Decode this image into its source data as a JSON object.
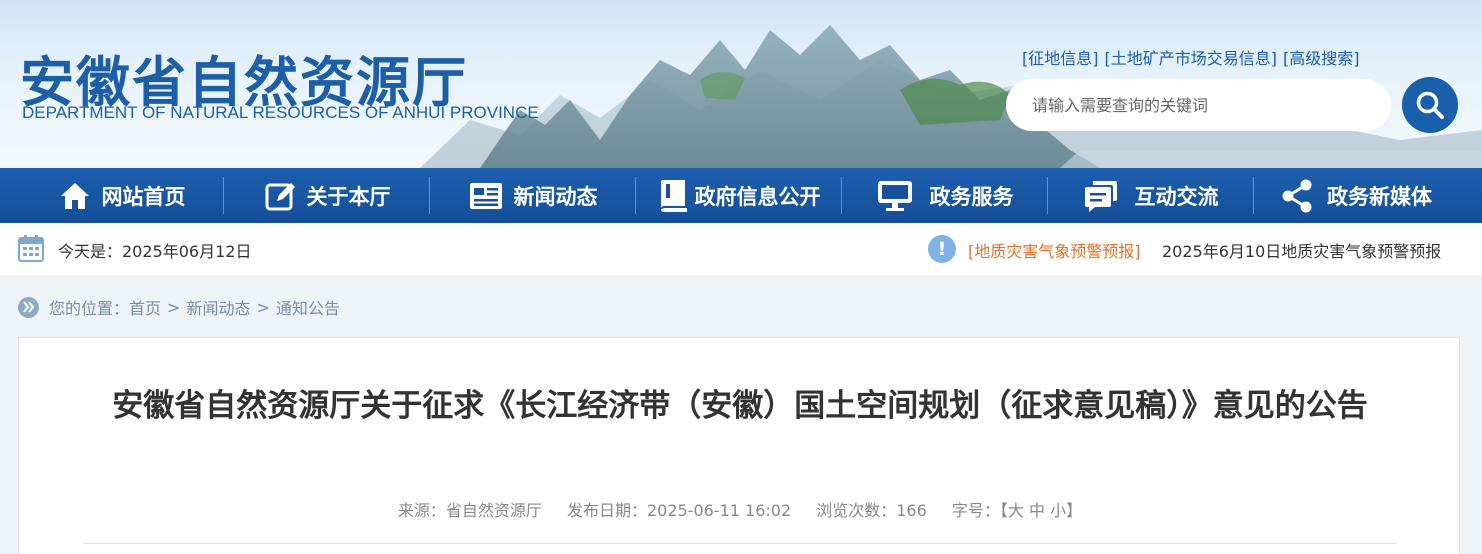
{
  "header": {
    "title_cn": "安徽省自然资源厅",
    "title_en": "DEPARTMENT OF NATURAL RESOURCES OF ANHUI PROVINCE",
    "top_links": [
      "[征地信息]",
      "[土地矿产市场交易信息]",
      "[高级搜索]"
    ],
    "search_placeholder": "请输入需要查询的关键词",
    "search_icon": "search-icon"
  },
  "nav": [
    {
      "label": "网站首页",
      "icon": "home-icon"
    },
    {
      "label": "关于本厅",
      "icon": "edit-icon"
    },
    {
      "label": "新闻动态",
      "icon": "news-icon"
    },
    {
      "label": "政府信息公开",
      "icon": "book-icon"
    },
    {
      "label": "政务服务",
      "icon": "monitor-icon"
    },
    {
      "label": "互动交流",
      "icon": "chat-icon"
    },
    {
      "label": "政务新媒体",
      "icon": "share-icon"
    }
  ],
  "infobar": {
    "date": "今天是：2025年06月12日",
    "alert_tag": "[地质灾害气象预警预报]",
    "alert_text": "2025年6月10日地质灾害气象预警预报"
  },
  "breadcrumb": {
    "prefix": "您的位置：",
    "items": [
      "首页",
      "新闻动态",
      "通知公告"
    ],
    "separator": ">"
  },
  "article": {
    "title": "安徽省自然资源厅关于征求《长江经济带（安徽）国土空间规划（征求意见稿）》意见的公告",
    "source": "来源：省自然资源厅",
    "date": "发布日期：2025-06-11 16:02",
    "views": "浏览次数：166",
    "font_label": "字号：",
    "font_open": "【",
    "font_sizes": [
      "大",
      "中",
      "小"
    ],
    "font_close": "】"
  },
  "colors": {
    "brand_blue": "#1d5ea8",
    "nav_blue": "#17509c",
    "alert_orange": "#e0712b"
  }
}
